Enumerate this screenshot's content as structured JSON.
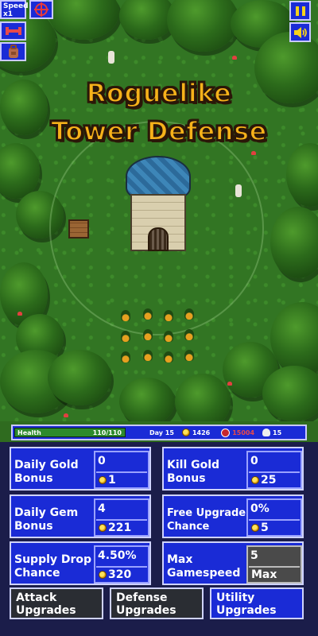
{
  "title": {
    "line1": "Roguelike",
    "line2": "Tower Defense"
  },
  "controls": {
    "speed_label": "Speed",
    "speed_value": "x1"
  },
  "status": {
    "health_label": "Health",
    "health_value": "110/110",
    "health_fraction": 1.0,
    "day": "Day 15",
    "gold": "1426",
    "gems": "15004",
    "kills": "15"
  },
  "upgrades": [
    {
      "name_line1": "Daily Gold",
      "name_line2": "Bonus",
      "value": "0",
      "cost": "1"
    },
    {
      "name_line1": "Kill Gold",
      "name_line2": "Bonus",
      "value": "0",
      "cost": "25"
    },
    {
      "name_line1": "Daily Gem",
      "name_line2": "Bonus",
      "value": "4",
      "cost": "221"
    },
    {
      "name_line1": "Free Upgrade",
      "name_line2": "Chance",
      "value": "0%",
      "cost": "5"
    },
    {
      "name_line1": "Supply Drop",
      "name_line2": "Chance",
      "value": "4.50%",
      "cost": "320"
    },
    {
      "name_line1": "Max",
      "name_line2": "Gamespeed",
      "value": "5",
      "cost": "Max"
    }
  ],
  "tabs": [
    {
      "line1": "Attack",
      "line2": "Upgrades"
    },
    {
      "line1": "Defense",
      "line2": "Upgrades"
    },
    {
      "line1": "Utility",
      "line2": "Upgrades"
    }
  ],
  "colors": {
    "panel_blue": "#1a2bd6",
    "title_gold": "#f7b21a",
    "pause_yellow": "#f7d21a"
  }
}
